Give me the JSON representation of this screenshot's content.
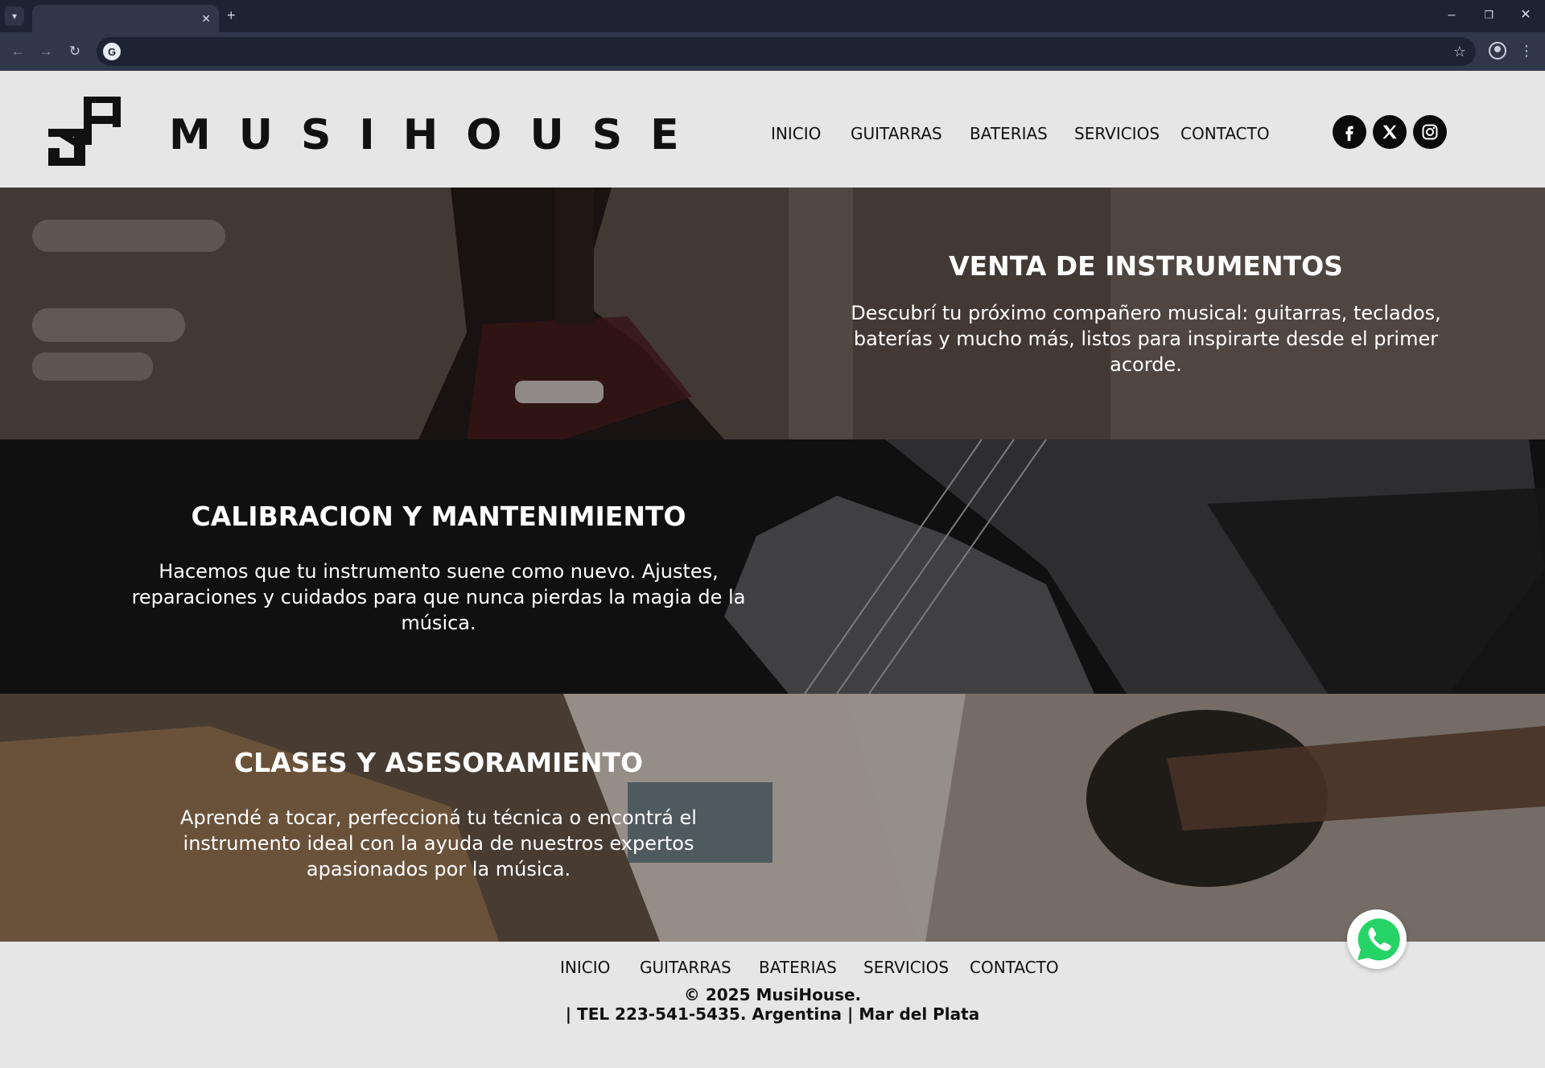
{
  "browser": {
    "tab_title": "",
    "url": "",
    "icons": {
      "tab_menu": "chevron-down-icon",
      "tab_close": "close-icon",
      "new_tab": "plus-icon",
      "minimize": "minimize-icon",
      "restore": "restore-icon",
      "close_window": "close-icon",
      "back": "back-arrow-icon",
      "forward": "forward-arrow-icon",
      "reload": "reload-icon",
      "site": "google-icon",
      "bookmark": "star-icon",
      "profile": "profile-icon",
      "menu": "kebab-menu-icon"
    }
  },
  "header": {
    "brand": "MUSIHOUSE",
    "logo_letters": "MH",
    "nav": [
      "INICIO",
      "GUITARRAS",
      "BATERIAS",
      "SERVICIOS",
      "CONTACTO"
    ],
    "social": [
      "facebook-icon",
      "x-icon",
      "instagram-icon"
    ]
  },
  "sections": [
    {
      "title": "VENTA DE INSTRUMENTOS",
      "text": "Descubrí tu próximo compañero musical: guitarras, teclados, baterías y mucho más, listos para inspirarte desde el primer acorde."
    },
    {
      "title": "CALIBRACION Y MANTENIMIENTO",
      "text": "Hacemos que tu instrumento suene como nuevo. Ajustes, reparaciones y cuidados para que nunca pierdas la magia de la música."
    },
    {
      "title": "CLASES Y ASESORAMIENTO",
      "text": "Aprendé a tocar, perfeccioná tu técnica o encontrá el instrumento ideal con la ayuda de nuestros expertos apasionados por la música."
    }
  ],
  "footer": {
    "nav": [
      "INICIO",
      "GUITARRAS",
      "BATERIAS",
      "SERVICIOS",
      "CONTACTO"
    ],
    "copyright": "© 2025 MusiHouse.",
    "contact": "| TEL 223-541-5435.  Argentina | Mar del Plata"
  },
  "floating": {
    "whatsapp_icon": "whatsapp-icon"
  },
  "colors": {
    "chrome_dark": "#1c2333",
    "chrome_mid": "#2f3749",
    "page_bg": "#e6e6e6",
    "text_dark": "#111111",
    "whatsapp_green": "#25d366"
  }
}
